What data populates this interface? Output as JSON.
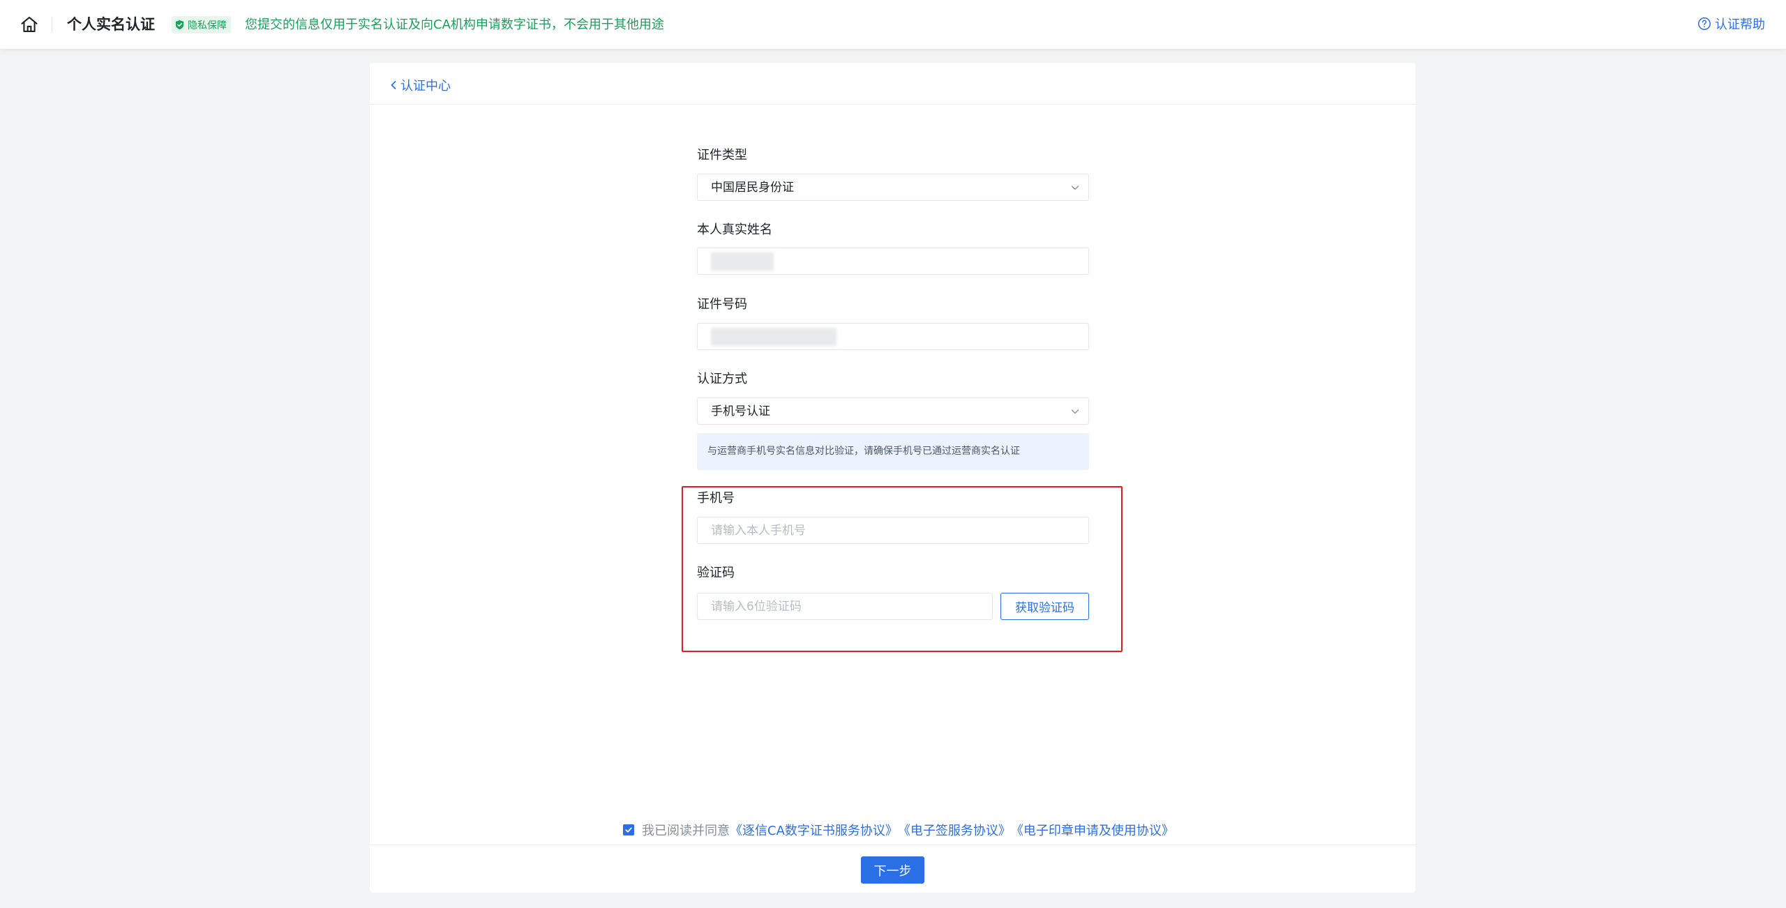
{
  "header": {
    "title": "个人实名认证",
    "privacy_badge": "隐私保障",
    "privacy_text": "您提交的信息仅用于实名认证及向CA机构申请数字证书，不会用于其他用途",
    "help_label": "认证帮助",
    "home_icon": "home-icon",
    "badge_icon": "shield-check-icon",
    "help_icon": "question-circle-icon"
  },
  "nav": {
    "back_label": "认证中心",
    "back_icon": "chevron-left-icon"
  },
  "form": {
    "id_type": {
      "label": "证件类型",
      "value": "中国居民身份证",
      "icon": "chevron-down-icon"
    },
    "real_name": {
      "label": "本人真实姓名",
      "value": ""
    },
    "id_number": {
      "label": "证件号码",
      "value": ""
    },
    "auth_method": {
      "label": "认证方式",
      "value": "手机号认证",
      "icon": "chevron-down-icon"
    },
    "notice": "与运营商手机号实名信息对比验证，请确保手机号已通过运营商实名认证",
    "phone": {
      "label": "手机号",
      "placeholder": "请输入本人手机号",
      "value": ""
    },
    "code": {
      "label": "验证码",
      "placeholder": "请输入6位验证码",
      "value": "",
      "button": "获取验证码"
    }
  },
  "agreement": {
    "checked": true,
    "prefix": "我已阅读并同意",
    "links": [
      "《逐信CA数字证书服务协议》",
      "《电子签服务协议》",
      "《电子印章申请及使用协议》"
    ]
  },
  "actions": {
    "next_label": "下一步"
  },
  "colors": {
    "accent": "#2b6fe6",
    "privacy_green": "#18a058",
    "highlight_red": "#e02020",
    "background": "#f2f3f5"
  }
}
